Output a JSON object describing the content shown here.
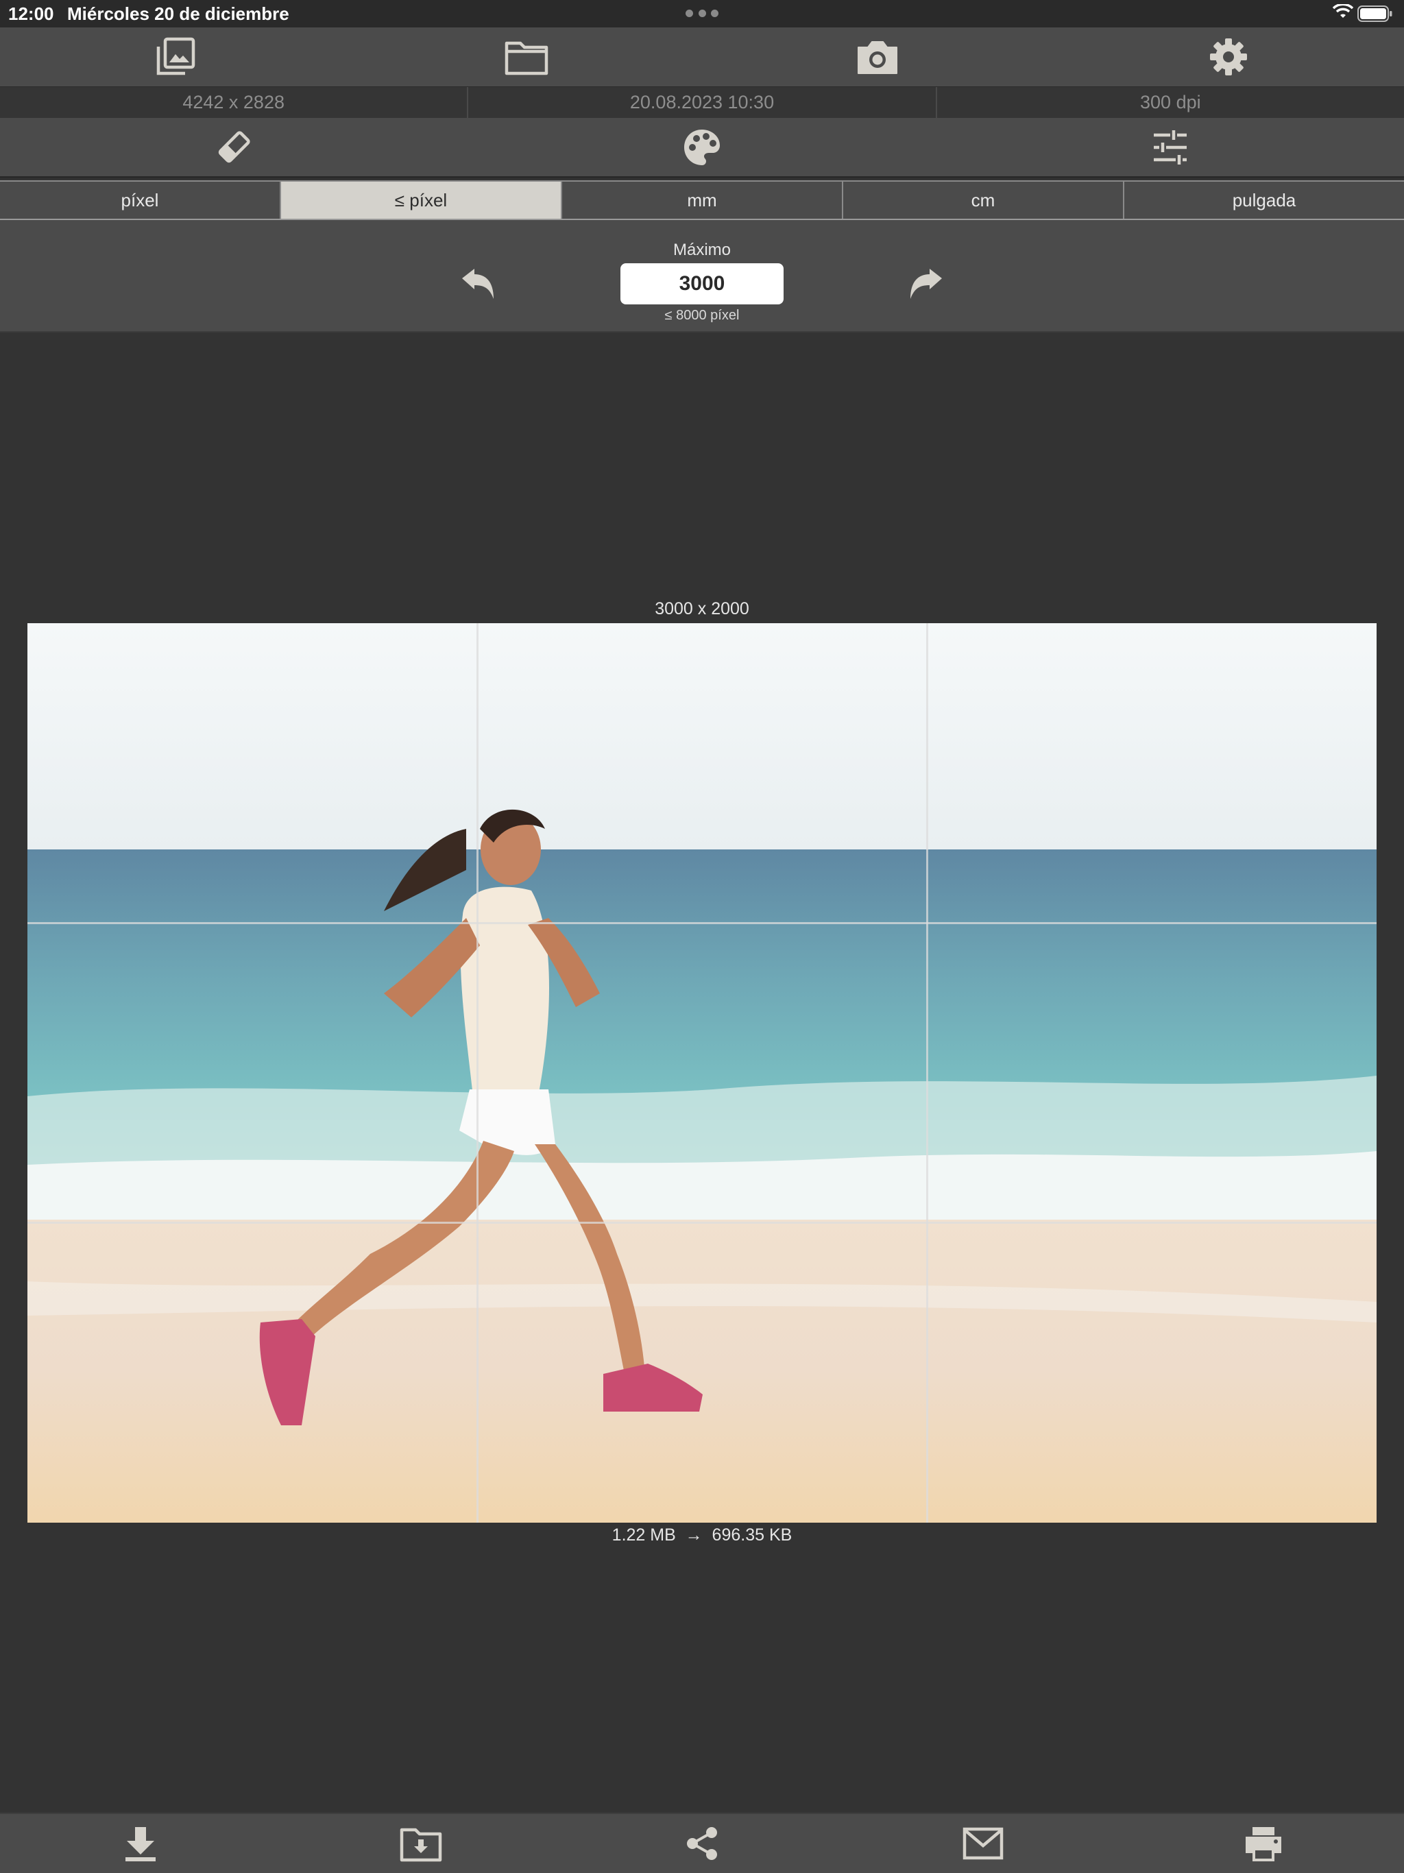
{
  "status_bar": {
    "time": "12:00",
    "date": "Miércoles 20 de diciembre"
  },
  "top_toolbar": {
    "buttons": [
      {
        "icon": "photo-library-icon"
      },
      {
        "icon": "folder-icon"
      },
      {
        "icon": "camera-icon"
      },
      {
        "icon": "gear-icon"
      }
    ]
  },
  "info_bar": {
    "dimensions": "4242 x 2828",
    "datetime": "20.08.2023 10:30",
    "resolution": "300 dpi"
  },
  "mid_toolbar": {
    "buttons": [
      {
        "icon": "eraser-icon"
      },
      {
        "icon": "palette-icon"
      },
      {
        "icon": "sliders-icon"
      }
    ]
  },
  "units": {
    "options": [
      "píxel",
      "≤ píxel",
      "mm",
      "cm",
      "pulgada"
    ],
    "selected": "≤ píxel"
  },
  "size_panel": {
    "label": "Máximo",
    "value": "3000",
    "hint": "≤ 8000 píxel"
  },
  "preview": {
    "output_dimensions": "3000 x 2000",
    "file_size": "1.22 MB  →  696.35 KB"
  },
  "bottom_toolbar": {
    "buttons": [
      {
        "icon": "download-icon"
      },
      {
        "icon": "folder-download-icon"
      },
      {
        "icon": "share-icon"
      },
      {
        "icon": "mail-icon"
      },
      {
        "icon": "print-icon"
      }
    ]
  },
  "colors": {
    "toolbar_bg": "#4b4b4b",
    "page_bg": "#333333",
    "icon": "#d6d3cc",
    "active_segment": "#d4d2cc"
  }
}
